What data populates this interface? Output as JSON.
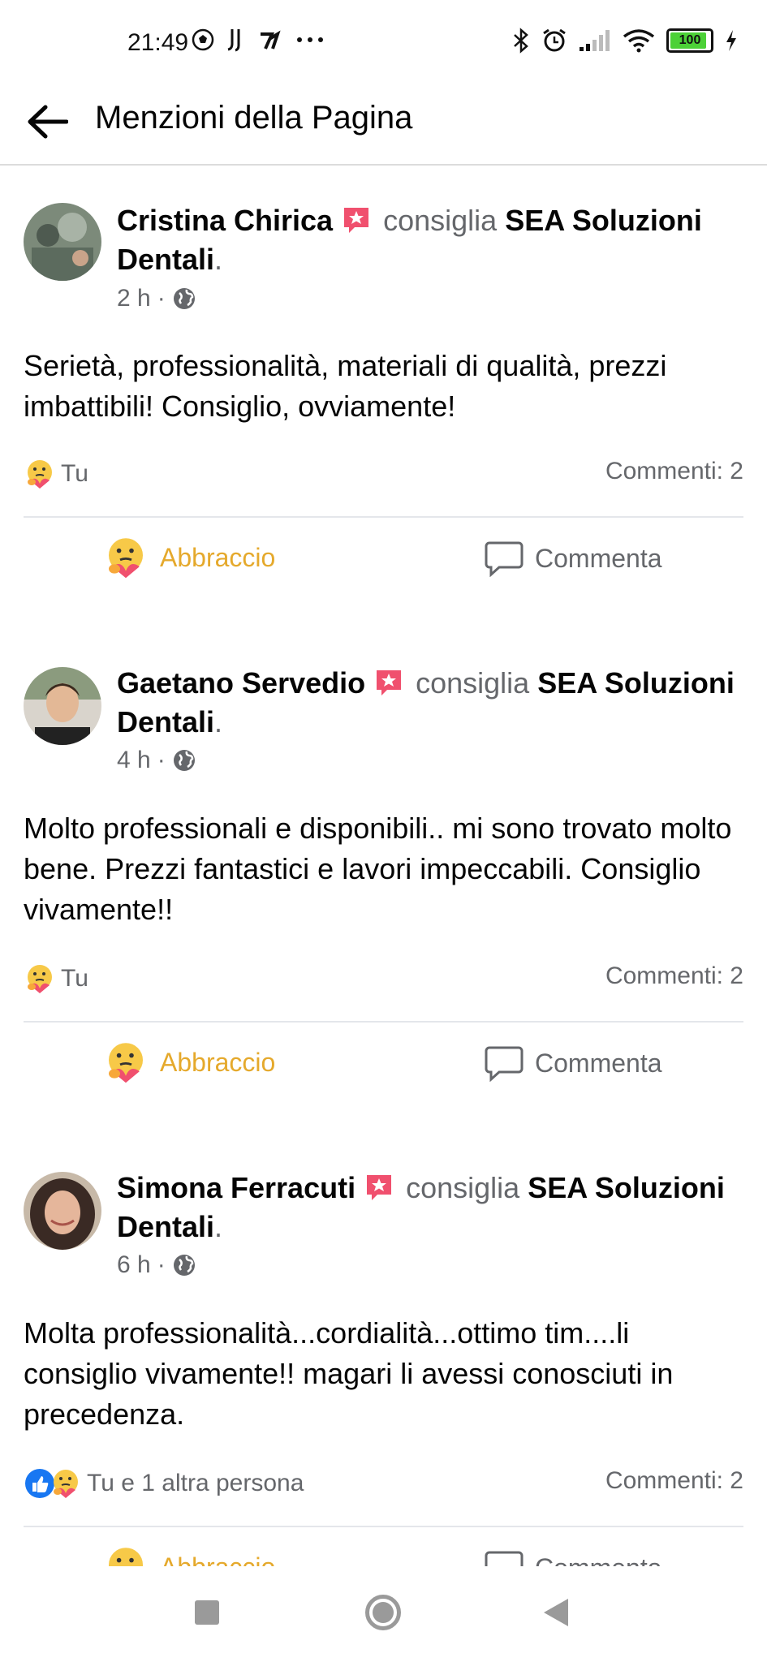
{
  "status_bar": {
    "time": "21:49",
    "battery": "100"
  },
  "app_bar": {
    "title": "Menzioni della Pagina"
  },
  "posts": [
    {
      "author": "Cristina Chirica",
      "verb": "consiglia",
      "page": "SEA Soluzioni Dentali",
      "period": ".",
      "time": "2 h",
      "separator": "·",
      "text": "Serietà, professionalità, materiali di qualità, prezzi imbattibili! Consiglio, ovviamente!",
      "reactions_text": "Tu",
      "comments": "Commenti: 2",
      "hug_label": "Abbraccio",
      "comment_label": "Commenta"
    },
    {
      "author": "Gaetano Servedio",
      "verb": "consiglia",
      "page": "SEA Soluzioni Dentali",
      "period": ".",
      "time": "4 h",
      "separator": "·",
      "text": "Molto professionali e disponibili.. mi sono trovato molto bene. Prezzi fantastici e lavori impeccabili. Consiglio vivamente!!",
      "reactions_text": "Tu",
      "comments": "Commenti: 2",
      "hug_label": "Abbraccio",
      "comment_label": "Commenta"
    },
    {
      "author": "Simona Ferracuti",
      "verb": "consiglia",
      "page": "SEA Soluzioni Dentali",
      "period": ".",
      "time": "6 h",
      "separator": "·",
      "text": "Molta professionalità...cordialità...ottimo tim....li consiglio vivamente!! magari li avessi conosciuti in precedenza.",
      "reactions_text": "Tu e 1 altra persona",
      "comments": "Commenti: 2",
      "hug_label": "Abbraccio",
      "comment_label": "Commenta"
    }
  ],
  "colors": {
    "hug": "#e5a92c",
    "secondary": "#65676b",
    "badge": "#f0506e",
    "like": "#1877f2"
  },
  "icons": [
    "back-arrow-icon",
    "recommend-star-icon",
    "globe-icon",
    "hug-emoji-icon",
    "like-icon",
    "comment-bubble-icon"
  ]
}
